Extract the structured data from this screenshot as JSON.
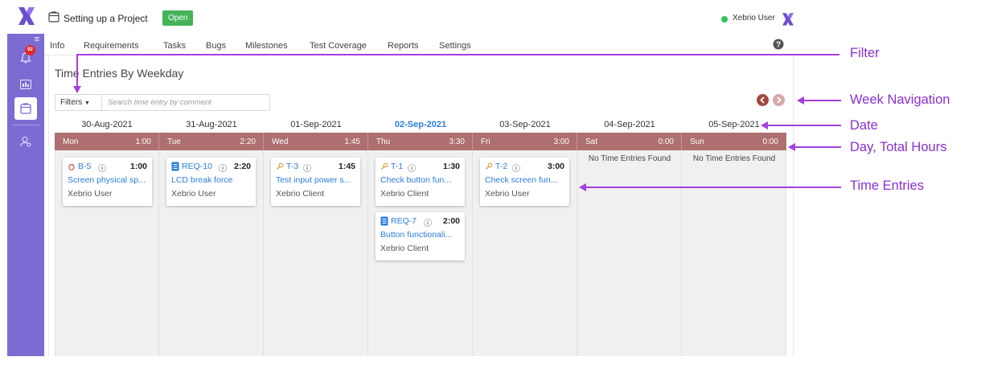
{
  "app": {
    "project_title": "Setting up a Project",
    "project_status": "Open",
    "user_name": "Xebrio User",
    "notification_count": "92"
  },
  "tabs": [
    "Info",
    "Requirements",
    "Tasks",
    "Bugs",
    "Milestones",
    "Test Coverage",
    "Reports",
    "Settings"
  ],
  "active_tab": "Reports",
  "page": {
    "title": "Time Entries By Weekday",
    "filters_label": "Filters",
    "search_placeholder": "Search time entry by comment"
  },
  "days": [
    {
      "date": "30-Aug-2021",
      "day": "Mon",
      "hours": "1:00",
      "today": false,
      "entries": [
        {
          "icon": "bug-icon",
          "id": "B-5",
          "duration": "1:00",
          "title": "Screen physical sp...",
          "user": "Xebrio User"
        }
      ]
    },
    {
      "date": "31-Aug-2021",
      "day": "Tue",
      "hours": "2:20",
      "today": false,
      "entries": [
        {
          "icon": "requirement-icon",
          "id": "REQ-10",
          "duration": "2:20",
          "title": "LCD break force",
          "user": "Xebrio User"
        }
      ]
    },
    {
      "date": "01-Sep-2021",
      "day": "Wed",
      "hours": "1:45",
      "today": false,
      "entries": [
        {
          "icon": "task-icon",
          "id": "T-3",
          "duration": "1:45",
          "title": "Test input power s...",
          "user": "Xebrio Client"
        }
      ]
    },
    {
      "date": "02-Sep-2021",
      "day": "Thu",
      "hours": "3:30",
      "today": true,
      "entries": [
        {
          "icon": "task-icon",
          "id": "T-1",
          "duration": "1:30",
          "title": "Check button fun...",
          "user": "Xebrio Client"
        },
        {
          "icon": "requirement-icon",
          "id": "REQ-7",
          "duration": "2:00",
          "title": "Button functionali...",
          "user": "Xebrio Client"
        }
      ]
    },
    {
      "date": "03-Sep-2021",
      "day": "Fri",
      "hours": "3:00",
      "today": false,
      "entries": [
        {
          "icon": "task-icon",
          "id": "T-2",
          "duration": "3:00",
          "title": "Check screen fun...",
          "user": "Xebrio User"
        }
      ]
    },
    {
      "date": "04-Sep-2021",
      "day": "Sat",
      "hours": "0:00",
      "today": false,
      "entries": [],
      "empty_text": "No Time Entries Found"
    },
    {
      "date": "05-Sep-2021",
      "day": "Sun",
      "hours": "0:00",
      "today": false,
      "entries": [],
      "empty_text": "No Time Entries Found"
    }
  ],
  "annotations": {
    "filter": "Filter",
    "week_navigation": "Week Navigation",
    "date": "Date",
    "day_total": "Day, Total Hours",
    "time_entries": "Time Entries"
  },
  "colors": {
    "accent": "#7b6cd3",
    "day_header": "#ad6f6f",
    "link": "#2a7de1",
    "annotation": "#a43fe0",
    "status_open": "#46b25a"
  }
}
